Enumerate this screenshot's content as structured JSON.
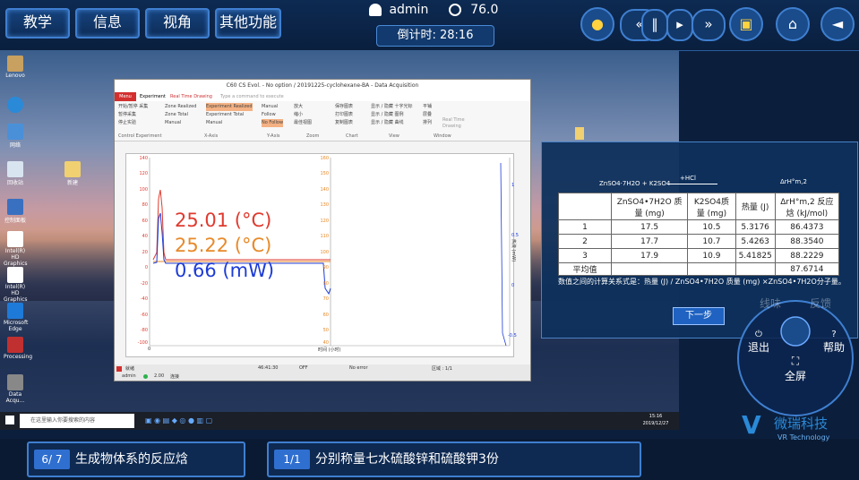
{
  "topbar": {
    "nav": [
      "教学",
      "信息",
      "视角",
      "其他功能"
    ],
    "user": "admin",
    "score": "76.0",
    "timer": "倒计时: 28:16"
  },
  "desktop": {
    "icons": [
      "Lenovo",
      "",
      "网络",
      "",
      "回收站",
      "新建",
      "",
      "控制面板",
      "Intel(R) HD Graphics ...",
      "Intel(R) HD Graphics ...",
      "Microsoft Edge",
      "Processing",
      "Data Acqu..."
    ],
    "taskbar_search": "在这里输入你要搜索的内容",
    "clock_time": "15:16",
    "clock_date": "2019/12/27"
  },
  "app": {
    "title": "C60 CS Evol. - No option  /  20191225-cyclohexane-BA  -  Data Acquisition",
    "tabs": [
      "Menu",
      "Experiment",
      "Real Time Drawing"
    ],
    "command_placeholder": "Type a command to execute",
    "ribbon_groups": [
      "Control Experiment",
      "X-Axis",
      "Y-Axis",
      "Zoom",
      "Chart",
      "View",
      "Window"
    ],
    "ribbon_items": {
      "control": [
        "开始/暂停 采集",
        "暂停采集",
        "停止实验"
      ],
      "xaxis": [
        "Zone Realized",
        "Zone Total",
        "Manual",
        "Experiment Realized",
        "Experiment Total",
        "Manual"
      ],
      "yaxis": [
        "Manual",
        "Follow",
        "No Follow"
      ],
      "zoom": [
        "放大",
        "缩小",
        "最佳视图"
      ],
      "chart": [
        "保存图表",
        "打印图表",
        "复制图表"
      ],
      "view": [
        "显示 / 隐藏 十字光标",
        "显示 / 隐藏 图例",
        "显示 / 隐藏 曲线"
      ],
      "window": [
        "平铺",
        "层叠",
        "排列",
        "Real Time Drawing"
      ]
    },
    "readout": {
      "t1": "25.01 (°C)",
      "t2": "25.22 (°C)",
      "power": "0.66 (mW)"
    },
    "left_ticks": [
      "140",
      "120",
      "100",
      "80",
      "60",
      "40",
      "20",
      "0",
      "-20",
      "-40",
      "-60",
      "-80",
      "-100"
    ],
    "mid_ticks": [
      "160",
      "150",
      "140",
      "130",
      "120",
      "110",
      "100",
      "90",
      "80",
      "70",
      "60",
      "50",
      "40"
    ],
    "right_ticks": [
      "1",
      "0.5",
      "0",
      "-0.5"
    ],
    "right_axis_label": "热流 (mW)",
    "x_label": "时间 (小时)",
    "x_zero": "0",
    "status": {
      "ready": "就绪",
      "user": "admin",
      "value": "2.00",
      "state": "连接",
      "time": "46:41:30",
      "off": "OFF",
      "error": "No error",
      "zone": "区域 : 1/1"
    }
  },
  "panel": {
    "reaction_left": "ZnSO4·7H2O  +  K2SO4",
    "reaction_top": "+HCl",
    "reaction_right": "ΔrH°m,2",
    "headers": [
      "",
      "ZnSO4•7H2O 质量 (mg)",
      "K2SO4质量 (mg)",
      "热量 (J)",
      "ΔrH°m,2 反应焓 (kJ/mol)"
    ],
    "rows": [
      [
        "1",
        "17.5",
        "10.5",
        "5.3176",
        "86.4373"
      ],
      [
        "2",
        "17.7",
        "10.7",
        "5.4263",
        "88.3540"
      ],
      [
        "3",
        "17.9",
        "10.9",
        "5.41825",
        "88.2229"
      ],
      [
        "平均值",
        "",
        "",
        "",
        "87.6714"
      ]
    ],
    "formula": "数值之间的计算关系式是：热量 (J) / ZnSO4•7H2O 质量 (mg) ×ZnSO4•7H2O分子量。",
    "next": "下一步"
  },
  "wheel": {
    "exit": "退出",
    "help": "帮助",
    "fullscreen": "全屏",
    "faded_left": "线味",
    "faded_right": "反馈"
  },
  "bottom": {
    "step1_num": "6/ 7",
    "step1_text": "生成物体系的反应焓",
    "step2_num": "1/1",
    "step2_text": "分别称量七水硫酸锌和硫酸钾3份"
  },
  "brand": {
    "name": "微瑞科技",
    "sub": "VR Technology"
  },
  "colors": {
    "accent": "#3f7fd0",
    "t1": "#e03a2e",
    "t2": "#e88a2a",
    "power": "#1c3bd6"
  }
}
